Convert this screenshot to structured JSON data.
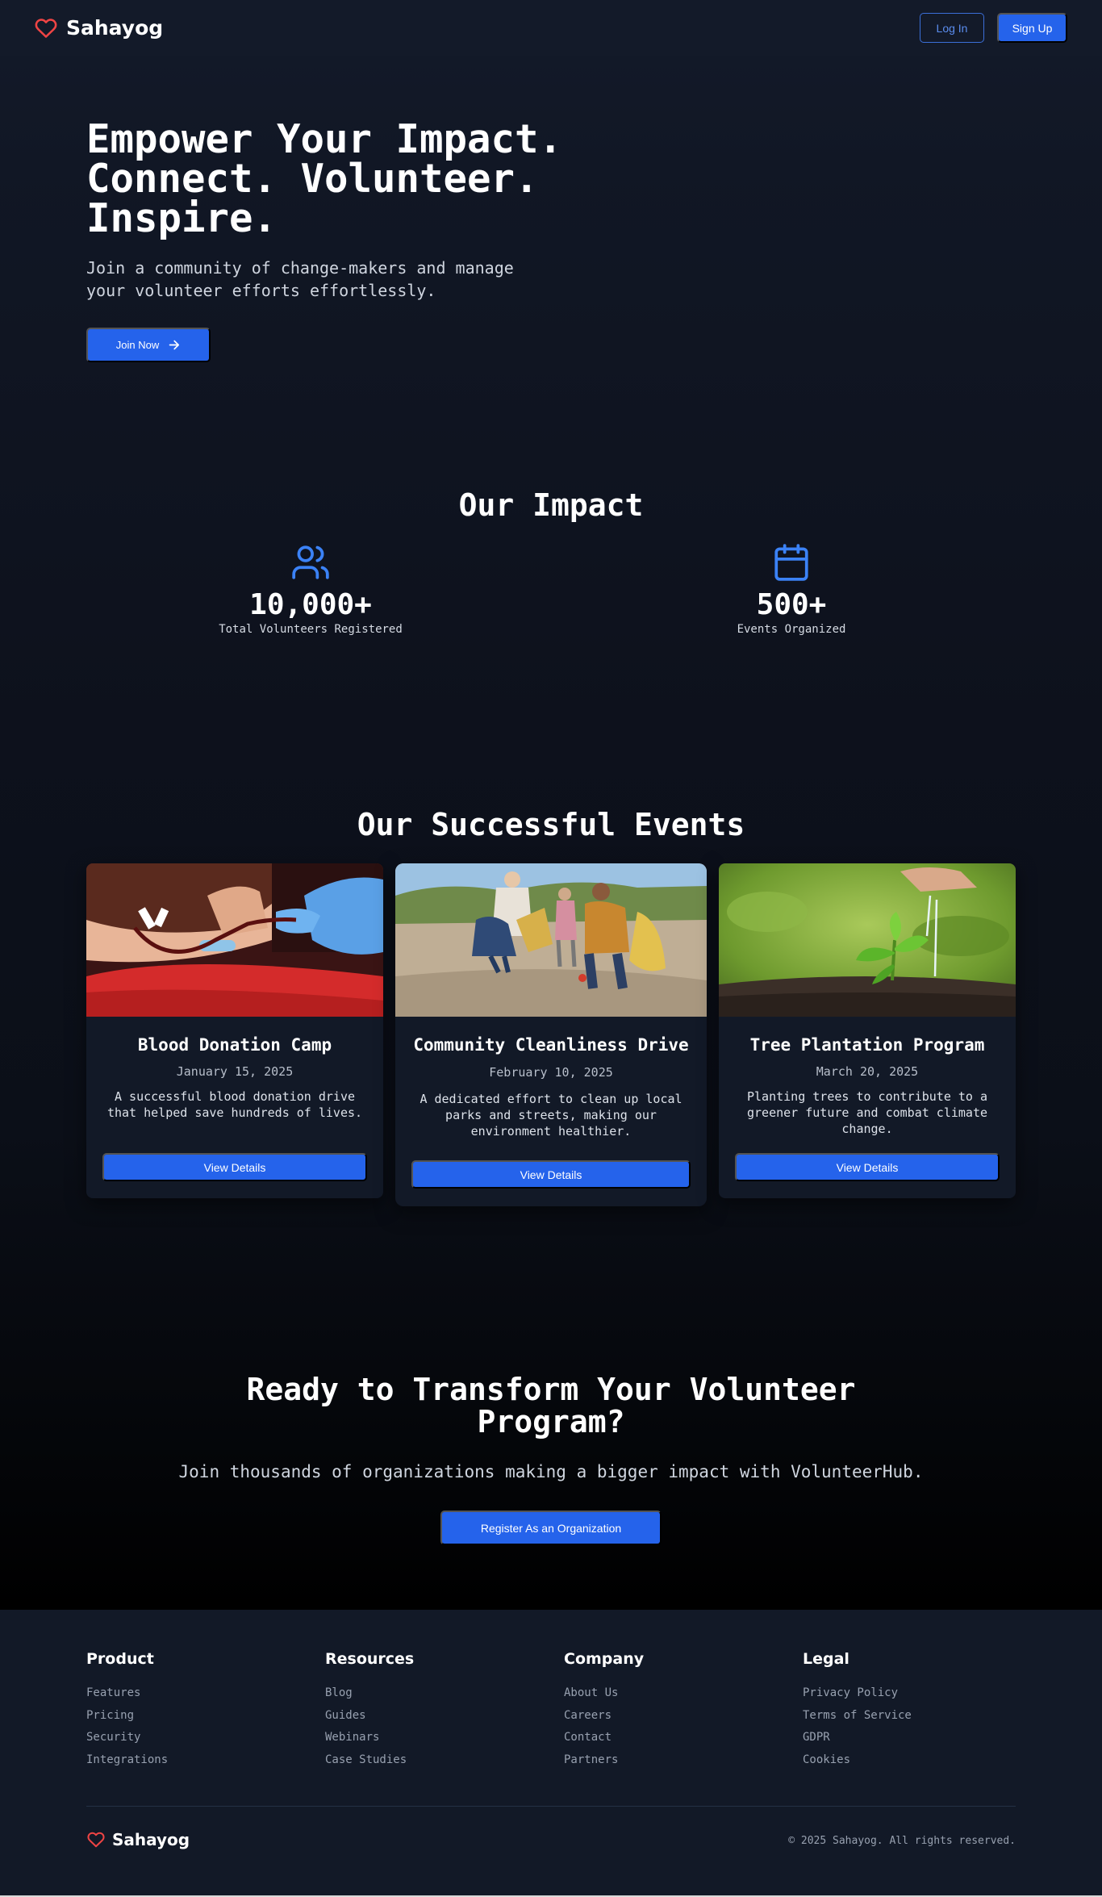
{
  "header": {
    "brand": "Sahayog",
    "login_label": "Log In",
    "signup_label": "Sign Up"
  },
  "hero": {
    "title_lines": [
      "Empower Your Impact.",
      "Connect. Volunteer.",
      "Inspire."
    ],
    "subtitle": "Join a community of change-makers and manage your volunteer efforts effortlessly.",
    "cta_label": "Join Now"
  },
  "impact": {
    "title": "Our Impact",
    "stats": [
      {
        "number": "10,000+",
        "label": "Total Volunteers Registered",
        "icon": "users-icon"
      },
      {
        "number": "500+",
        "label": "Events Organized",
        "icon": "calendar-icon"
      }
    ]
  },
  "events": {
    "title": "Our Successful Events",
    "items": [
      {
        "title": "Blood Donation Camp",
        "date": "January 15, 2025",
        "description": "A successful blood donation drive that helped save hundreds of lives.",
        "button": "View Details"
      },
      {
        "title": "Community Cleanliness Drive",
        "date": "February 10, 2025",
        "description": "A dedicated effort to clean up local parks and streets, making our environment healthier.",
        "button": "View Details"
      },
      {
        "title": "Tree Plantation Program",
        "date": "March 20, 2025",
        "description": "Planting trees to contribute to a greener future and combat climate change.",
        "button": "View Details"
      }
    ]
  },
  "cta": {
    "title": "Ready to Transform Your Volunteer Program?",
    "subtitle": "Join thousands of organizations making a bigger impact with VolunteerHub.",
    "button": "Register As an Organization"
  },
  "footer": {
    "columns": [
      {
        "heading": "Product",
        "links": [
          "Features",
          "Pricing",
          "Security",
          "Integrations"
        ]
      },
      {
        "heading": "Resources",
        "links": [
          "Blog",
          "Guides",
          "Webinars",
          "Case Studies"
        ]
      },
      {
        "heading": "Company",
        "links": [
          "About Us",
          "Careers",
          "Contact",
          "Partners"
        ]
      },
      {
        "heading": "Legal",
        "links": [
          "Privacy Policy",
          "Terms of Service",
          "GDPR",
          "Cookies"
        ]
      }
    ],
    "brand": "Sahayog",
    "copyright": "© 2025 Sahayog. All rights reserved."
  },
  "colors": {
    "accent": "#2563eb",
    "heart": "#ef4444",
    "background": "#111725"
  }
}
